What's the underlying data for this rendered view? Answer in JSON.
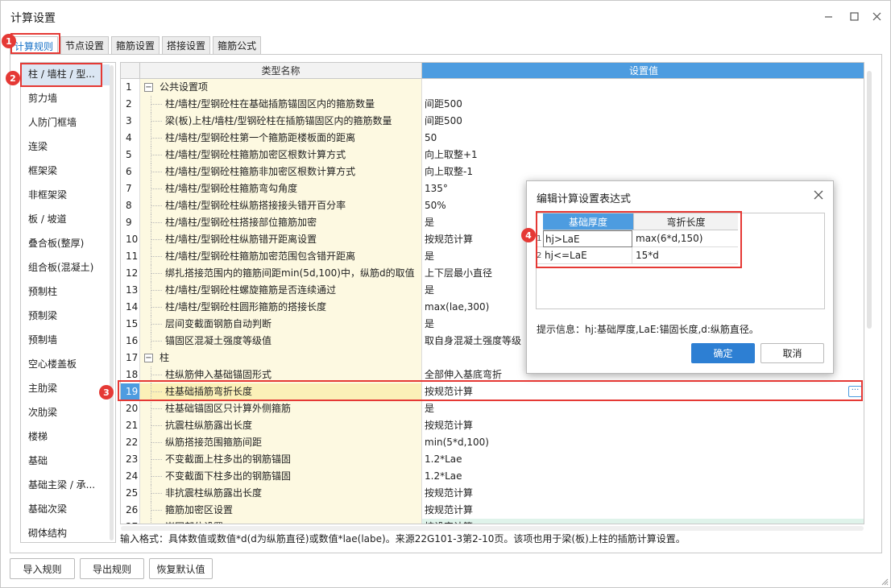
{
  "window": {
    "title": "计算设置",
    "accent_color": "#4d9ce0",
    "highlight_color": "#e53935"
  },
  "tabs": [
    {
      "label": "计算规则",
      "active": true
    },
    {
      "label": "节点设置",
      "active": false
    },
    {
      "label": "箍筋设置",
      "active": false
    },
    {
      "label": "搭接设置",
      "active": false
    },
    {
      "label": "箍筋公式",
      "active": false
    }
  ],
  "sidebar": {
    "items": [
      {
        "label": "柱 / 墙柱 / 型...",
        "selected": true
      },
      {
        "label": "剪力墙"
      },
      {
        "label": "人防门框墙"
      },
      {
        "label": "连梁"
      },
      {
        "label": "框架梁"
      },
      {
        "label": "非框架梁"
      },
      {
        "label": "板 / 坡道"
      },
      {
        "label": "叠合板(整厚)"
      },
      {
        "label": "组合板(混凝土)"
      },
      {
        "label": "预制柱"
      },
      {
        "label": "预制梁"
      },
      {
        "label": "预制墙"
      },
      {
        "label": "空心楼盖板"
      },
      {
        "label": "主肋梁"
      },
      {
        "label": "次肋梁"
      },
      {
        "label": "楼梯"
      },
      {
        "label": "基础"
      },
      {
        "label": "基础主梁 / 承..."
      },
      {
        "label": "基础次梁"
      },
      {
        "label": "砌体结构"
      }
    ]
  },
  "grid": {
    "headers": {
      "name": "类型名称",
      "value": "设置值"
    },
    "rows": [
      {
        "n": "1",
        "name": "公共设置项",
        "value": "",
        "group": true
      },
      {
        "n": "2",
        "name": "柱/墙柱/型钢砼柱在基础插筋锚固区内的箍筋数量",
        "value": "间距500"
      },
      {
        "n": "3",
        "name": "梁(板)上柱/墙柱/型钢砼柱在插筋锚固区内的箍筋数量",
        "value": "间距500"
      },
      {
        "n": "4",
        "name": "柱/墙柱/型钢砼柱第一个箍筋距楼板面的距离",
        "value": "50"
      },
      {
        "n": "5",
        "name": "柱/墙柱/型钢砼柱箍筋加密区根数计算方式",
        "value": "向上取整+1"
      },
      {
        "n": "6",
        "name": "柱/墙柱/型钢砼柱箍筋非加密区根数计算方式",
        "value": "向上取整-1"
      },
      {
        "n": "7",
        "name": "柱/墙柱/型钢砼柱箍筋弯勾角度",
        "value": "135°"
      },
      {
        "n": "8",
        "name": "柱/墙柱/型钢砼柱纵筋搭接接头错开百分率",
        "value": "50%"
      },
      {
        "n": "9",
        "name": "柱/墙柱/型钢砼柱搭接部位箍筋加密",
        "value": "是"
      },
      {
        "n": "10",
        "name": "柱/墙柱/型钢砼柱纵筋错开距离设置",
        "value": "按规范计算"
      },
      {
        "n": "11",
        "name": "柱/墙柱/型钢砼柱箍筋加密范围包含错开距离",
        "value": "是"
      },
      {
        "n": "12",
        "name": "绑扎搭接范围内的箍筋间距min(5d,100)中，纵筋d的取值",
        "value": "上下层最小直径"
      },
      {
        "n": "13",
        "name": "柱/墙柱/型钢砼柱螺旋箍筋是否连续通过",
        "value": "是"
      },
      {
        "n": "14",
        "name": "柱/墙柱/型钢砼柱圆形箍筋的搭接长度",
        "value": "max(lae,300)"
      },
      {
        "n": "15",
        "name": "层间变截面钢筋自动判断",
        "value": "是"
      },
      {
        "n": "16",
        "name": "锚固区混凝土强度等级值",
        "value": "取自身混凝土强度等级"
      },
      {
        "n": "17",
        "name": "柱",
        "value": "",
        "group": true
      },
      {
        "n": "18",
        "name": "柱纵筋伸入基础锚固形式",
        "value": "全部伸入基底弯折"
      },
      {
        "n": "19",
        "name": "柱基础插筋弯折长度",
        "value": "按规范计算",
        "selected": true
      },
      {
        "n": "20",
        "name": "柱基础锚固区只计算外侧箍筋",
        "value": "是"
      },
      {
        "n": "21",
        "name": "抗震柱纵筋露出长度",
        "value": "按规范计算"
      },
      {
        "n": "22",
        "name": "纵筋搭接范围箍筋间距",
        "value": "min(5*d,100)"
      },
      {
        "n": "23",
        "name": "不变截面上柱多出的钢筋锚固",
        "value": "1.2*Lae"
      },
      {
        "n": "24",
        "name": "不变截面下柱多出的钢筋锚固",
        "value": "1.2*Lae"
      },
      {
        "n": "25",
        "name": "非抗震柱纵筋露出长度",
        "value": "按规范计算"
      },
      {
        "n": "26",
        "name": "箍筋加密区设置",
        "value": "按规范计算"
      },
      {
        "n": "27",
        "name": "嵌固部位设置",
        "value": "按设定计算",
        "green": true
      }
    ],
    "row_dots": "···"
  },
  "hint": "输入格式：具体数值或数值*d(d为纵筋直径)或数值*lae(labe)。来源22G101-3第2-10页。该项也用于梁(板)上柱的插筋计算设置。",
  "buttons": {
    "import": "导入规则",
    "export": "导出规则",
    "restore": "恢复默认值"
  },
  "markers": [
    "1",
    "2",
    "3",
    "4"
  ],
  "dialog": {
    "title": "编辑计算设置表达式",
    "headers": [
      "基础厚度",
      "弯折长度"
    ],
    "rows": [
      {
        "n": "1",
        "cond": "hj>LaE",
        "expr": "max(6*d,150)"
      },
      {
        "n": "2",
        "cond": "hj<=LaE",
        "expr": "15*d"
      }
    ],
    "info": "提示信息：hj:基础厚度,LaE:锚固长度,d:纵筋直径。",
    "ok": "确定",
    "cancel": "取消"
  }
}
